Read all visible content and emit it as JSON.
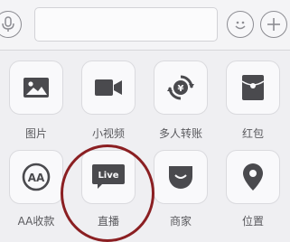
{
  "input_bar": {
    "voice_icon": "microphone-icon",
    "emoji_icon": "smiley-icon",
    "plus_icon": "plus-icon",
    "input_value": ""
  },
  "panel": {
    "items": [
      {
        "label": "图片",
        "icon": "image-icon"
      },
      {
        "label": "小视频",
        "icon": "video-camera-icon"
      },
      {
        "label": "多人转账",
        "icon": "yuan-transfer-icon"
      },
      {
        "label": "红包",
        "icon": "red-envelope-icon"
      },
      {
        "label": "AA收款",
        "icon": "aa-icon"
      },
      {
        "label": "直播",
        "icon": "live-icon",
        "badge": "Live"
      },
      {
        "label": "商家",
        "icon": "shop-icon"
      },
      {
        "label": "位置",
        "icon": "location-pin-icon"
      }
    ]
  },
  "colors": {
    "icon": "#4a4a4e",
    "highlight_circle": "#8b1f22",
    "tile_bg": "#f9f9fb"
  }
}
